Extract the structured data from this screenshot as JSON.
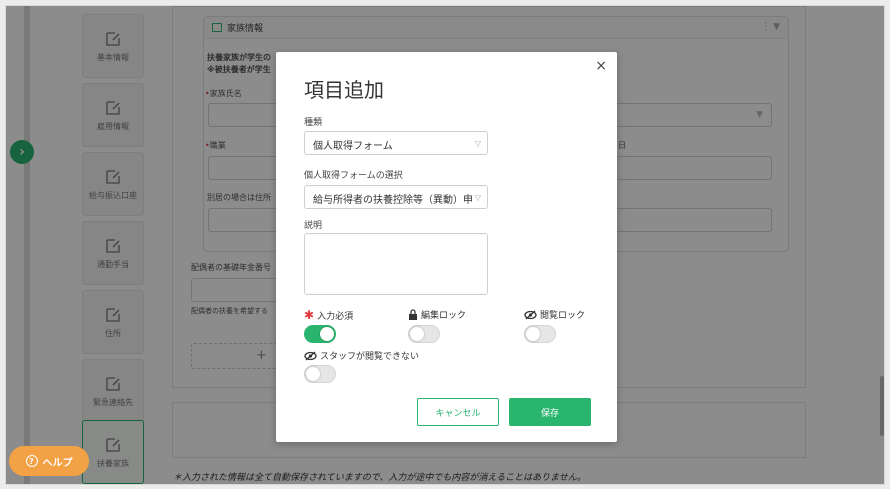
{
  "sidebar": {
    "toggle_glyph": "›",
    "steps": [
      {
        "label": "基本情報",
        "icon": "edit-icon"
      },
      {
        "label": "雇用情報",
        "icon": "edit-icon"
      },
      {
        "label": "給与振込口座",
        "icon": "edit-icon"
      },
      {
        "label": "通勤手当",
        "icon": "edit-icon"
      },
      {
        "label": "住所",
        "icon": "edit-icon"
      },
      {
        "label": "緊急連絡先",
        "icon": "edit-icon"
      },
      {
        "label": "扶養家族",
        "icon": "edit-icon"
      }
    ]
  },
  "form": {
    "section_title": "家族情報",
    "section_tools": "⋮  ▼",
    "note_line1": "扶養家族が学生の",
    "note_line2": "※被扶養者が学生",
    "family_name_label": "家族氏名",
    "occupation_label": "職業",
    "separate_address_label": "別居の場合は住所",
    "date_suffix": "日",
    "spouse_pension_label": "配偶者の基礎年金番号",
    "spouse_dependent_label": "配偶者の扶養を希望する",
    "add_plus": "+"
  },
  "footnote": "＊入力された情報は全て自動保存されていますので、入力が途中でも内容が消えることはありません。",
  "help_button": {
    "label": "ヘルプ",
    "icon_glyph": "?"
  },
  "modal": {
    "title": "項目追加",
    "close_glyph": "×",
    "type_label": "種類",
    "type_value": "個人取得フォーム",
    "form_select_label": "個人取得フォームの選択",
    "form_select_value": "給与所得者の扶養控除等（異動）申",
    "description_label": "説明",
    "required_mark": "✱",
    "required_label": "入力必須",
    "edit_lock_label": "編集ロック",
    "view_lock_label": "閲覧ロック",
    "staff_hidden_label": "スタッフが閲覧できない",
    "toggles": {
      "required": true,
      "edit_lock": false,
      "view_lock": false,
      "staff_hidden": false
    },
    "cancel_label": "キャンセル",
    "save_label": "保存"
  },
  "colors": {
    "accent": "#2ab56f",
    "help": "#f2a144",
    "required": "#e0393e"
  }
}
